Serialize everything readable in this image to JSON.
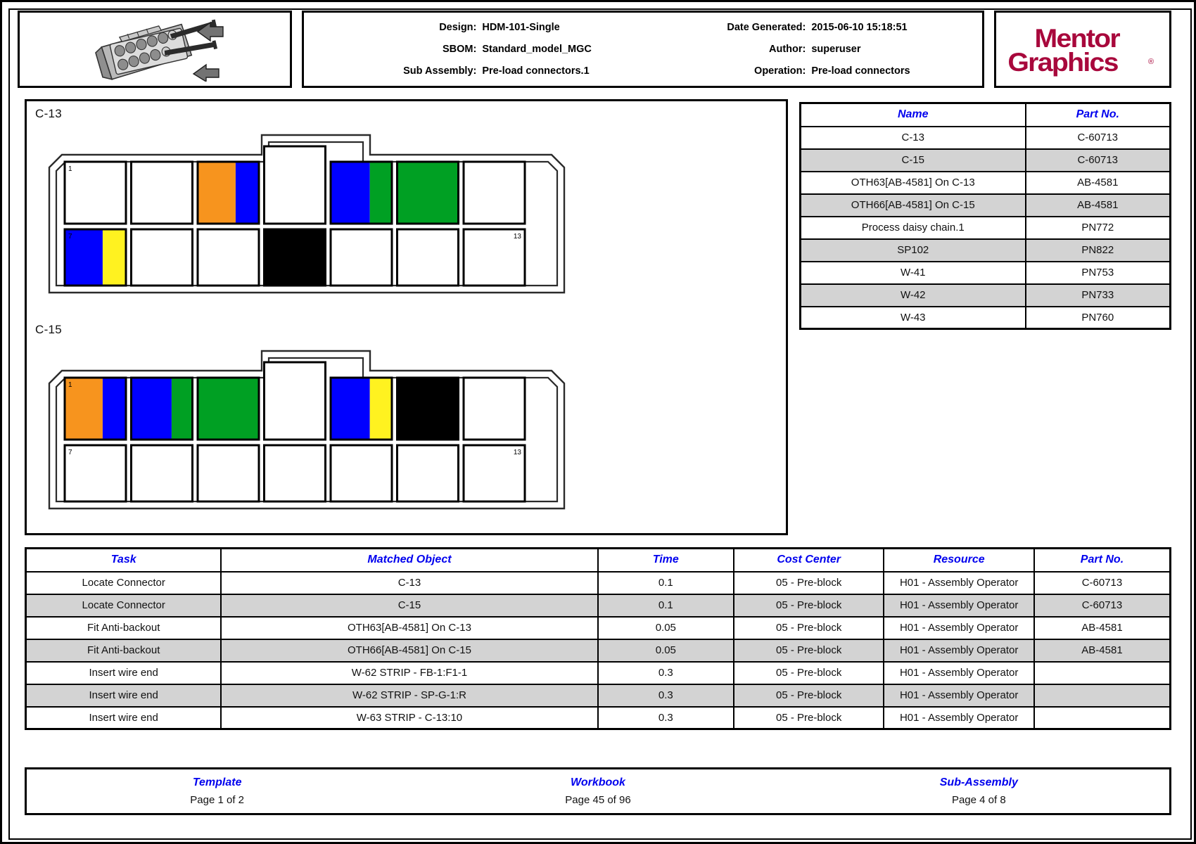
{
  "header": {
    "thumbnail_icon": "connector-insertion-illustration",
    "meta": [
      {
        "label": "Design:",
        "value": "HDM-101-Single"
      },
      {
        "label": "Date Generated:",
        "value": "2015-06-10 15:18:51"
      },
      {
        "label": "SBOM:",
        "value": "Standard_model_MGC"
      },
      {
        "label": "Author:",
        "value": "superuser"
      },
      {
        "label": "Sub Assembly:",
        "value": "Pre-load connectors.1"
      },
      {
        "label": "Operation:",
        "value": "Pre-load connectors"
      }
    ],
    "logo": {
      "line1": "Mentor",
      "line2": "Graphics",
      "trademark": "®",
      "color": "#A8083C"
    }
  },
  "diagram": {
    "connectors": [
      {
        "label": "C-13",
        "first_pin": "1",
        "mid_pin": "7",
        "last_pin": "13",
        "top_row": [
          {
            "colors": [
              "#FFFFFF"
            ],
            "split": [
              100
            ]
          },
          {
            "colors": [
              "#FFFFFF"
            ],
            "split": [
              100
            ]
          },
          {
            "colors": [
              "#F7941E",
              "#0000FF"
            ],
            "split": [
              62,
              38
            ]
          },
          {
            "colors": [
              "#FFFFFF"
            ],
            "split": [
              100
            ]
          },
          {
            "colors": [
              "#0000FF",
              "#00A023"
            ],
            "split": [
              64,
              36
            ]
          },
          {
            "colors": [
              "#00A023"
            ],
            "split": [
              100
            ]
          },
          {
            "colors": [
              "#FFFFFF"
            ],
            "split": [
              100
            ]
          }
        ],
        "bottom_row": [
          {
            "colors": [
              "#0000FF",
              "#FFF220"
            ],
            "split": [
              62,
              38
            ]
          },
          {
            "colors": [
              "#FFFFFF"
            ],
            "split": [
              100
            ]
          },
          {
            "colors": [
              "#FFFFFF"
            ],
            "split": [
              100
            ]
          },
          {
            "colors": [
              "#000000"
            ],
            "split": [
              100
            ]
          },
          {
            "colors": [
              "#FFFFFF"
            ],
            "split": [
              100
            ]
          },
          {
            "colors": [
              "#FFFFFF"
            ],
            "split": [
              100
            ]
          },
          {
            "colors": [
              "#FFFFFF"
            ],
            "split": [
              100
            ]
          }
        ]
      },
      {
        "label": "C-15",
        "first_pin": "1",
        "mid_pin": "7",
        "last_pin": "13",
        "top_row": [
          {
            "colors": [
              "#F7941E",
              "#0000FF"
            ],
            "split": [
              62,
              38
            ]
          },
          {
            "colors": [
              "#0000FF",
              "#00A023"
            ],
            "split": [
              66,
              34
            ]
          },
          {
            "colors": [
              "#00A023"
            ],
            "split": [
              100
            ]
          },
          {
            "colors": [
              "#FFFFFF"
            ],
            "split": [
              100
            ]
          },
          {
            "colors": [
              "#0000FF",
              "#FFF220"
            ],
            "split": [
              64,
              36
            ]
          },
          {
            "colors": [
              "#000000"
            ],
            "split": [
              100
            ]
          },
          {
            "colors": [
              "#FFFFFF"
            ],
            "split": [
              100
            ]
          }
        ],
        "bottom_row": [
          {
            "colors": [
              "#FFFFFF"
            ],
            "split": [
              100
            ]
          },
          {
            "colors": [
              "#FFFFFF"
            ],
            "split": [
              100
            ]
          },
          {
            "colors": [
              "#FFFFFF"
            ],
            "split": [
              100
            ]
          },
          {
            "colors": [
              "#FFFFFF"
            ],
            "split": [
              100
            ]
          },
          {
            "colors": [
              "#FFFFFF"
            ],
            "split": [
              100
            ]
          },
          {
            "colors": [
              "#FFFFFF"
            ],
            "split": [
              100
            ]
          },
          {
            "colors": [
              "#FFFFFF"
            ],
            "split": [
              100
            ]
          }
        ]
      }
    ]
  },
  "parts_table": {
    "headers": [
      "Name",
      "Part No."
    ],
    "rows": [
      [
        "C-13",
        "C-60713"
      ],
      [
        "C-15",
        "C-60713"
      ],
      [
        "OTH63[AB-4581] On C-13",
        "AB-4581"
      ],
      [
        "OTH66[AB-4581] On C-15",
        "AB-4581"
      ],
      [
        "Process daisy chain.1",
        "PN772"
      ],
      [
        "SP102",
        "PN822"
      ],
      [
        "W-41",
        "PN753"
      ],
      [
        "W-42",
        "PN733"
      ],
      [
        "W-43",
        "PN760"
      ]
    ]
  },
  "task_table": {
    "headers": [
      "Task",
      "Matched Object",
      "Time",
      "Cost Center",
      "Resource",
      "Part No."
    ],
    "rows": [
      [
        "Locate Connector",
        "C-13",
        "0.1",
        "05 - Pre-block",
        "H01 - Assembly Operator",
        "C-60713"
      ],
      [
        "Locate Connector",
        "C-15",
        "0.1",
        "05 - Pre-block",
        "H01 - Assembly Operator",
        "C-60713"
      ],
      [
        "Fit Anti-backout",
        "OTH63[AB-4581] On C-13",
        "0.05",
        "05 - Pre-block",
        "H01 - Assembly Operator",
        "AB-4581"
      ],
      [
        "Fit Anti-backout",
        "OTH66[AB-4581] On C-15",
        "0.05",
        "05 - Pre-block",
        "H01 - Assembly Operator",
        "AB-4581"
      ],
      [
        "Insert wire end",
        "W-62 STRIP - FB-1:F1-1",
        "0.3",
        "05 - Pre-block",
        "H01 - Assembly Operator",
        ""
      ],
      [
        "Insert wire end",
        "W-62 STRIP - SP-G-1:R",
        "0.3",
        "05 - Pre-block",
        "H01 - Assembly Operator",
        ""
      ],
      [
        "Insert wire end",
        "W-63 STRIP - C-13:10",
        "0.3",
        "05 - Pre-block",
        "H01 - Assembly Operator",
        ""
      ]
    ]
  },
  "footer": {
    "cells": [
      {
        "title": "Template",
        "page": "Page 1 of 2"
      },
      {
        "title": "Workbook",
        "page": "Page 45 of 96"
      },
      {
        "title": "Sub-Assembly",
        "page": "Page 4 of 8"
      }
    ]
  }
}
